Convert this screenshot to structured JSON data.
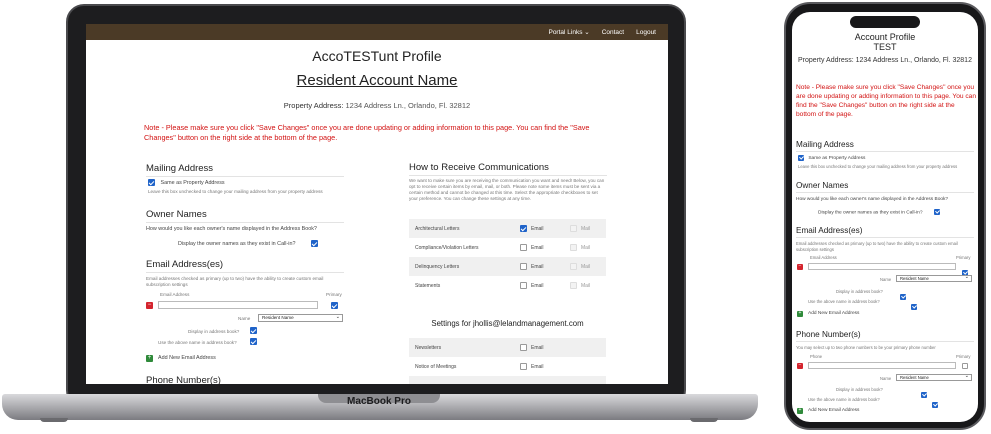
{
  "laptop": {
    "brand": "MacBook Pro",
    "nav": {
      "portal_links": "Portal Links ⌄",
      "contact": "Contact",
      "logout": "Logout"
    },
    "title": "AccoTESTunt Profile",
    "subtitle": "Resident Account Name",
    "property_label": "Property Address:",
    "property_value": "1234 Address Ln., Orlando, Fl. 32812",
    "note": "Note - Please make sure you click \"Save Changes\" once you are done updating or adding information to this page. You can find the \"Save Changes\" button on the right side at the bottom of the page.",
    "mailing": {
      "heading": "Mailing Address",
      "same_label": "Same as Property Address",
      "hint": "Leave this box unchecked to change your mailing address from your property address"
    },
    "owners": {
      "heading": "Owner Names",
      "question": "How would you like each owner's name displayed in the Address Book?",
      "display_label": "Display the owner names as they exist in Call-in?"
    },
    "email": {
      "heading": "Email Address(es)",
      "hint": "Email addresses checked as primary (up to two) have the ability to create custom email subscription settings",
      "field_label": "Email Address",
      "primary_label": "Primary",
      "name_label": "Name",
      "name_value": "Resident Name",
      "display_label": "Display in address book?",
      "use_name_label": "Use the above name in address book?",
      "add_label": "Add New Email Address"
    },
    "phone_heading": "Phone Number(s)",
    "comms": {
      "heading": "How to Receive Communications",
      "intro": "We want to make sure you are receiving the communication you want and need! Below, you can opt to receive certain items by email, mail, or both. Please note some items must be sent via a certain method and cannot be changed at this time. Select the appropriate checkboxes to set your preference. You can change these settings at any time.",
      "email_label": "Email",
      "mail_label": "Mail",
      "rows": [
        {
          "label": "Architectural Letters",
          "email": true
        },
        {
          "label": "Compliance/Violation Letters",
          "email": false
        },
        {
          "label": "Delinquency Letters",
          "email": false
        },
        {
          "label": "Statements",
          "email": false
        }
      ]
    },
    "settings": {
      "heading": "Settings for jhollis@lelandmanagement.com",
      "email_label": "Email",
      "rows": [
        {
          "label": "Newsletters"
        },
        {
          "label": "Notice of Meetings"
        }
      ]
    }
  },
  "phone": {
    "title_line1": "Account Profile",
    "title_line2": "TEST",
    "property_label": "Property Address:",
    "property_value": "1234 Address Ln., Orlando, Fl. 32812",
    "note": "Note - Please make sure you click \"Save Changes\" once you are done updating or adding information to this page. You can find the \"Save Changes\" button on the right side at the bottom of the page.",
    "mailing": {
      "heading": "Mailing Address",
      "same_label": "Same as Property Address",
      "hint": "Leave this box unchecked to change your mailing address from your property address"
    },
    "owners": {
      "heading": "Owner Names",
      "question": "How would you like each owner's name displayed in the Address Book?",
      "display_label": "Display the owner names as they exist in Call-in?"
    },
    "email": {
      "heading": "Email Address(es)",
      "hint": "Email addresses checked as primary (up to two) have the ability to create custom email subscription settings",
      "field_label": "Email Address",
      "primary_label": "Primary",
      "name_label": "Name",
      "name_value": "Resident Name",
      "display_label": "Display in address book?",
      "use_name_label": "Use the above name in address book?",
      "add_label": "Add New Email Address"
    },
    "phones": {
      "heading": "Phone Number(s)",
      "hint": "You may select up to two phone numbers to be your primary phone number",
      "field_label": "Phone",
      "primary_label": "Primary",
      "name_label": "Name",
      "name_value": "Resident Name",
      "display_label": "Display in address book?",
      "use_name_label": "Use the above name in address book?",
      "add_label": "Add New Email Address"
    }
  }
}
